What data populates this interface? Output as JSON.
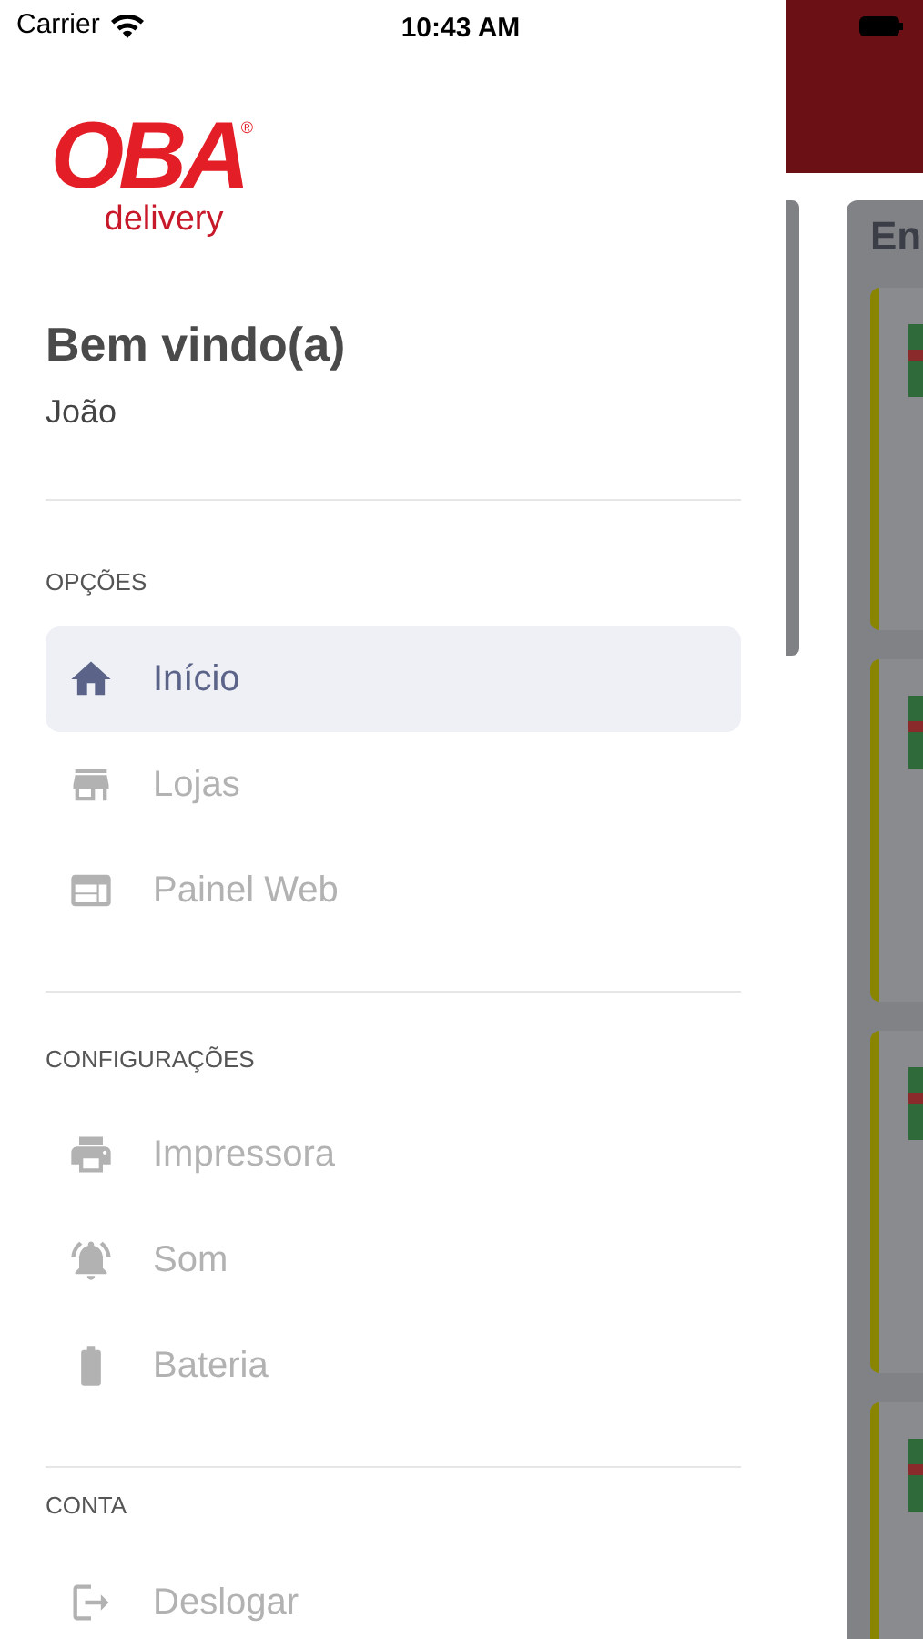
{
  "status_bar": {
    "carrier": "Carrier",
    "time": "10:43 AM"
  },
  "drawer": {
    "logo": {
      "wordmark": "OBA",
      "registered": "®",
      "tagline": "delivery"
    },
    "welcome": "Bem vindo(a)",
    "user": "João",
    "sections": [
      {
        "title": "OPÇÕES",
        "items": [
          {
            "label": "Início",
            "kind": "home",
            "selected": true
          },
          {
            "label": "Lojas",
            "kind": "store",
            "selected": false
          },
          {
            "label": "Painel Web",
            "kind": "web",
            "selected": false
          }
        ]
      },
      {
        "title": "CONFIGURAÇÕES",
        "items": [
          {
            "label": "Impressora",
            "kind": "print",
            "selected": false
          },
          {
            "label": "Som",
            "kind": "bell",
            "selected": false
          },
          {
            "label": "Bateria",
            "kind": "battery",
            "selected": false
          }
        ]
      },
      {
        "title": "CONTA",
        "items": [
          {
            "label": "Deslogar",
            "kind": "logout",
            "selected": false
          }
        ]
      }
    ]
  },
  "background": {
    "heading": "En",
    "cards": [
      {
        "kind": "order"
      },
      {
        "kind": "order"
      },
      {
        "kind": "order"
      },
      {
        "kind": "order"
      }
    ]
  }
}
